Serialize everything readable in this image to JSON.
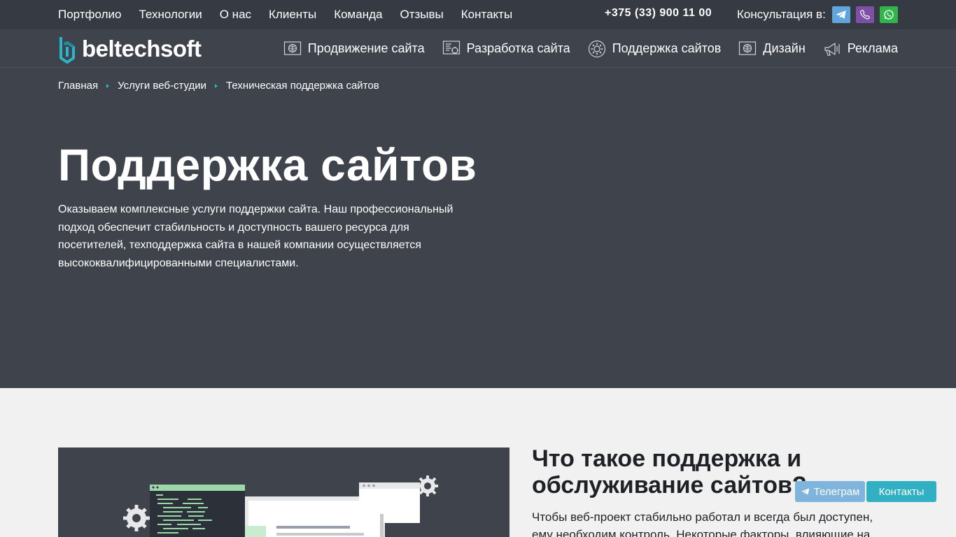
{
  "topbar": {
    "nav": [
      "Портфолио",
      "Технологии",
      "О нас",
      "Клиенты",
      "Команда",
      "Отзывы",
      "Контакты"
    ],
    "phone": "+375 (33) 900 11 00",
    "consult_label": "Консультация в:",
    "messengers": [
      {
        "name": "telegram-icon",
        "color": "#5ea6dc"
      },
      {
        "name": "viber-icon",
        "color": "#7d4fa6"
      },
      {
        "name": "whatsapp-icon",
        "color": "#2fb548"
      }
    ]
  },
  "header": {
    "logo_text": "beltechsoft",
    "logo_color": "#2bb5c8",
    "menu": [
      {
        "label": "Продвижение сайта",
        "icon": "globe-monitor-icon"
      },
      {
        "label": "Разработка сайта",
        "icon": "dev-monitor-icon"
      },
      {
        "label": "Поддержка сайтов",
        "icon": "gear-circle-icon"
      },
      {
        "label": "Дизайн",
        "icon": "globe-monitor-icon"
      },
      {
        "label": "Реклама",
        "icon": "megaphone-icon"
      }
    ]
  },
  "breadcrumbs": [
    "Главная",
    "Услуги веб-студии",
    "Техническая поддержка сайтов"
  ],
  "hero": {
    "title": "Поддержка сайтов",
    "description": "Оказываем комплексные услуги поддержки сайта. Наш профессиональный подход обеспечит стабильность и доступность вашего ресурса для посетителей, техподдержка сайта в нашей компании осуществляется высококвалифицированными специалистами."
  },
  "section": {
    "title": "Что такое поддержка и обслуживание сайтов?",
    "text": "Чтобы веб-проект стабильно работал и всегда был доступен, ему необходим контроль. Некоторые факторы, влияющие на"
  },
  "floating": {
    "telegram_label": "Телеграм",
    "contacts_label": "Контакты"
  },
  "colors": {
    "accent": "#2bb5c8",
    "dark_bg": "#3e434c",
    "topbar_bg": "#363a42"
  }
}
